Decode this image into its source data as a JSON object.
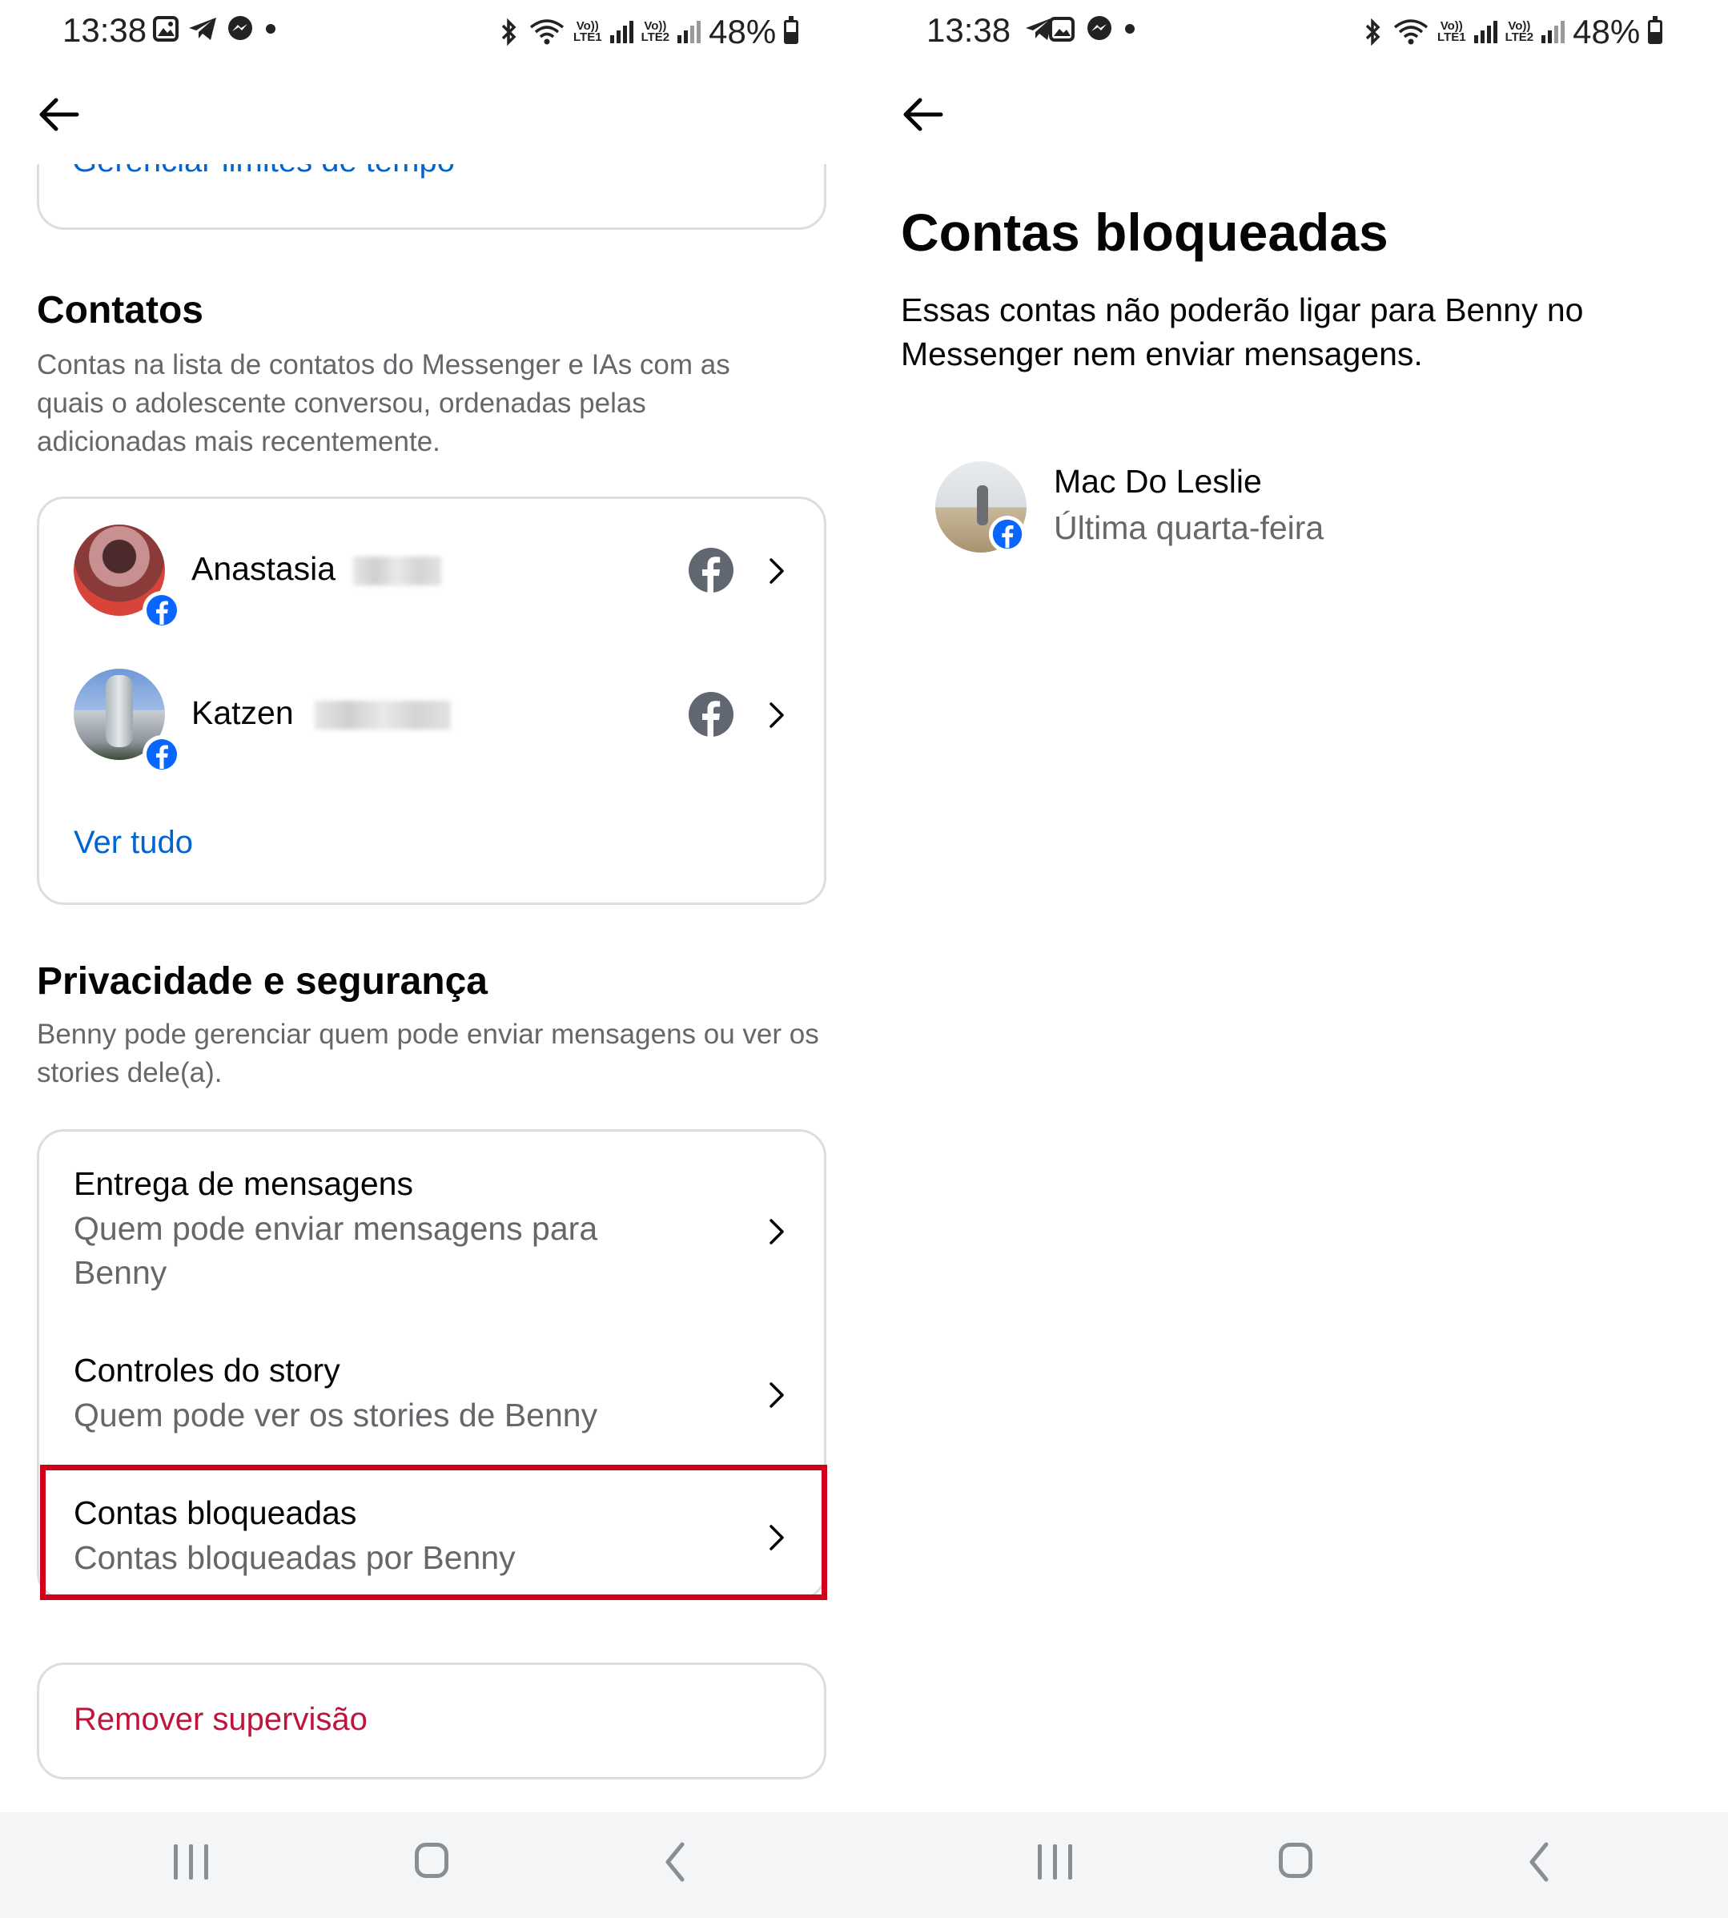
{
  "colors": {
    "link": "#0064d1",
    "danger": "#c0143c",
    "highlight": "#d0021b",
    "secondary_text": "#65676b"
  },
  "left_screen": {
    "status_bar": {
      "time": "13:38",
      "battery": "48%",
      "lte1": "LTE1",
      "lte2": "LTE2",
      "volte": "Vo))"
    },
    "cut_off_text": "Gerenciar limites de tempo",
    "contacts": {
      "title": "Contatos",
      "description": "Contas na lista de contatos do Messenger e IAs com as quais o adolescente conversou, ordenadas pelas adicionadas mais recentemente.",
      "items": [
        {
          "name": "Anastasia",
          "icon": "facebook-icon"
        },
        {
          "name": "Katzen",
          "icon": "facebook-icon"
        }
      ],
      "see_all": "Ver tudo"
    },
    "privacy": {
      "title": "Privacidade e segurança",
      "description": "Benny pode gerenciar quem pode enviar mensagens ou ver os stories dele(a).",
      "items": [
        {
          "title": "Entrega de mensagens",
          "subtitle": "Quem pode enviar mensagens para Benny"
        },
        {
          "title": "Controles do story",
          "subtitle": "Quem pode ver os stories de Benny"
        },
        {
          "title": "Contas bloqueadas",
          "subtitle": "Contas bloqueadas por Benny",
          "highlighted": true
        }
      ]
    },
    "remove_supervision": "Remover supervisão"
  },
  "right_screen": {
    "status_bar": {
      "time": "13:38",
      "battery": "48%",
      "lte1": "LTE1",
      "lte2": "LTE2",
      "volte": "Vo))"
    },
    "title": "Contas bloqueadas",
    "description": "Essas contas não poderão ligar para Benny no Messenger nem enviar mensagens.",
    "blocked": [
      {
        "name": "Mac Do Leslie",
        "date": "Última quarta-feira"
      }
    ]
  }
}
